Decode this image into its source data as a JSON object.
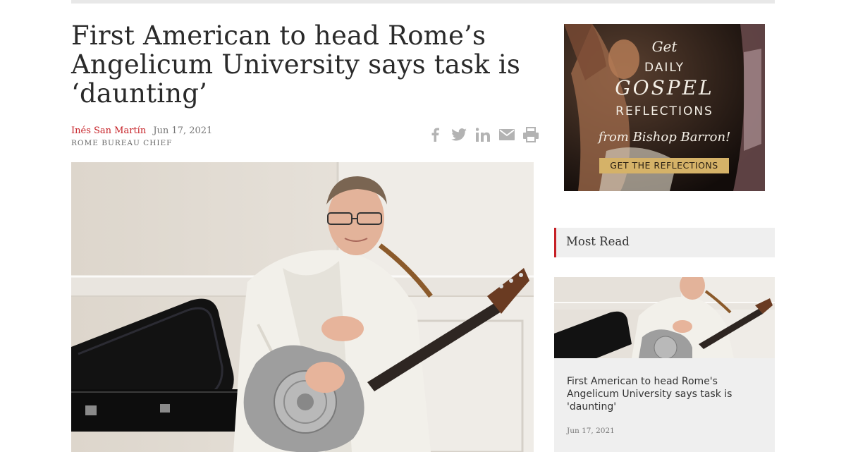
{
  "article": {
    "title": "First American to head Rome’s Angelicum University says task is ‘daunting’",
    "author": "Inés San Martín",
    "date": "Jun 17, 2021",
    "role": "ROME BUREAU CHIEF",
    "hero_alt": "Priest in white habit holding a resonator guitar"
  },
  "share": {
    "icons": [
      "facebook-icon",
      "twitter-icon",
      "linkedin-icon",
      "email-icon",
      "print-icon"
    ]
  },
  "ad": {
    "line1": "Get",
    "line2": "DAILY",
    "line3": "GOSPEL",
    "line4": "REFLECTIONS",
    "line5": "from Bishop Barron!",
    "cta": "GET THE REFLECTIONS"
  },
  "sidebar": {
    "most_read_label": "Most Read",
    "card": {
      "title": "First American to head Rome's Angelicum University says task is 'daunting'",
      "date": "Jun 17, 2021"
    }
  },
  "colors": {
    "accent": "#c62026",
    "panel": "#efefef",
    "gold": "#d5b268"
  }
}
